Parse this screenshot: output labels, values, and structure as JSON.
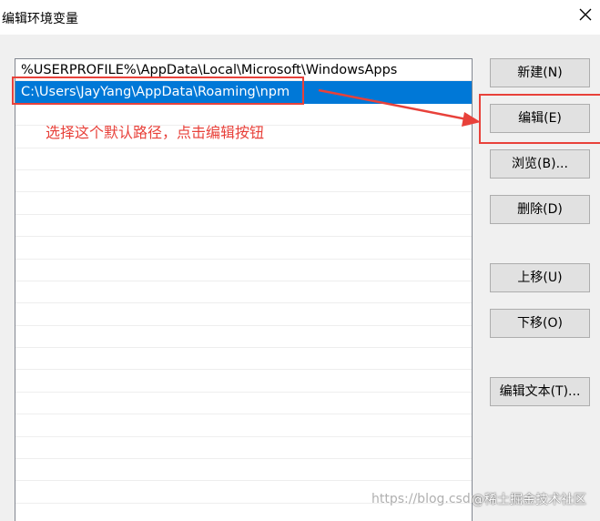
{
  "window": {
    "title": "编辑环境变量",
    "close_glyph": "✕"
  },
  "list": {
    "rows": [
      {
        "text": "%USERPROFILE%\\AppData\\Local\\Microsoft\\WindowsApps",
        "selected": false
      },
      {
        "text": "C:\\Users\\JayYang\\AppData\\Roaming\\npm",
        "selected": true
      },
      {
        "text": "",
        "selected": false
      },
      {
        "text": "",
        "selected": false
      },
      {
        "text": "",
        "selected": false
      },
      {
        "text": "",
        "selected": false
      },
      {
        "text": "",
        "selected": false
      },
      {
        "text": "",
        "selected": false
      },
      {
        "text": "",
        "selected": false
      },
      {
        "text": "",
        "selected": false
      },
      {
        "text": "",
        "selected": false
      },
      {
        "text": "",
        "selected": false
      },
      {
        "text": "",
        "selected": false
      },
      {
        "text": "",
        "selected": false
      },
      {
        "text": "",
        "selected": false
      },
      {
        "text": "",
        "selected": false
      },
      {
        "text": "",
        "selected": false
      },
      {
        "text": "",
        "selected": false
      },
      {
        "text": "",
        "selected": false
      },
      {
        "text": "",
        "selected": false
      },
      {
        "text": "",
        "selected": false
      }
    ]
  },
  "buttons": {
    "new": "新建(N)",
    "edit": "编辑(E)",
    "browse": "浏览(B)...",
    "delete": "删除(D)",
    "move_up": "上移(U)",
    "move_down": "下移(O)",
    "edit_text": "编辑文本(T)..."
  },
  "annotation": {
    "text": "选择这个默认路径，点击编辑按钮",
    "color": "#e8413a"
  },
  "watermark": {
    "left": "https://blog.csdn",
    "right": "@稀土掘金技术社区"
  },
  "colors": {
    "selection": "#0078d7",
    "annotation": "#e8413a"
  }
}
